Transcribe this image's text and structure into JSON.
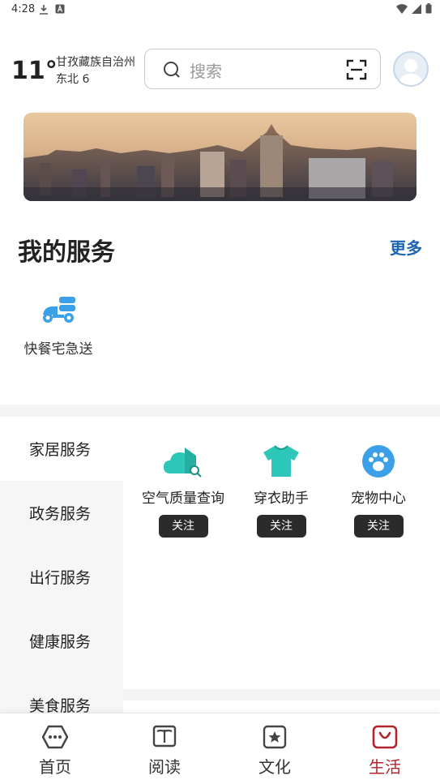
{
  "status_bar": {
    "time": "4:28"
  },
  "header": {
    "temperature": "11°",
    "location": "甘孜藏族自治州",
    "wind": "东北  6",
    "search_placeholder": "搜索"
  },
  "my_services": {
    "title": "我的服务",
    "more": "更多",
    "items": [
      {
        "label": "快餐宅急送",
        "icon": "scooter-icon"
      }
    ]
  },
  "categories": [
    {
      "label": "家居服务"
    },
    {
      "label": "政务服务"
    },
    {
      "label": "出行服务"
    },
    {
      "label": "健康服务"
    },
    {
      "label": "美食服务"
    }
  ],
  "category_items": [
    {
      "label": "空气质量查询",
      "follow": "关注",
      "icon": "cloud-house-icon"
    },
    {
      "label": "穿衣助手",
      "follow": "关注",
      "icon": "tshirt-icon"
    },
    {
      "label": "宠物中心",
      "follow": "关注",
      "icon": "paw-icon"
    }
  ],
  "bottom_nav": [
    {
      "label": "首页",
      "icon": "home-icon"
    },
    {
      "label": "阅读",
      "icon": "book-icon"
    },
    {
      "label": "文化",
      "icon": "star-badge-icon"
    },
    {
      "label": "生活",
      "icon": "bag-icon"
    }
  ],
  "colors": {
    "accent_blue": "#1e64b4",
    "active_red": "#b0242b",
    "service_icon": "#3ba0e8",
    "teal": "#2cc7b8"
  }
}
